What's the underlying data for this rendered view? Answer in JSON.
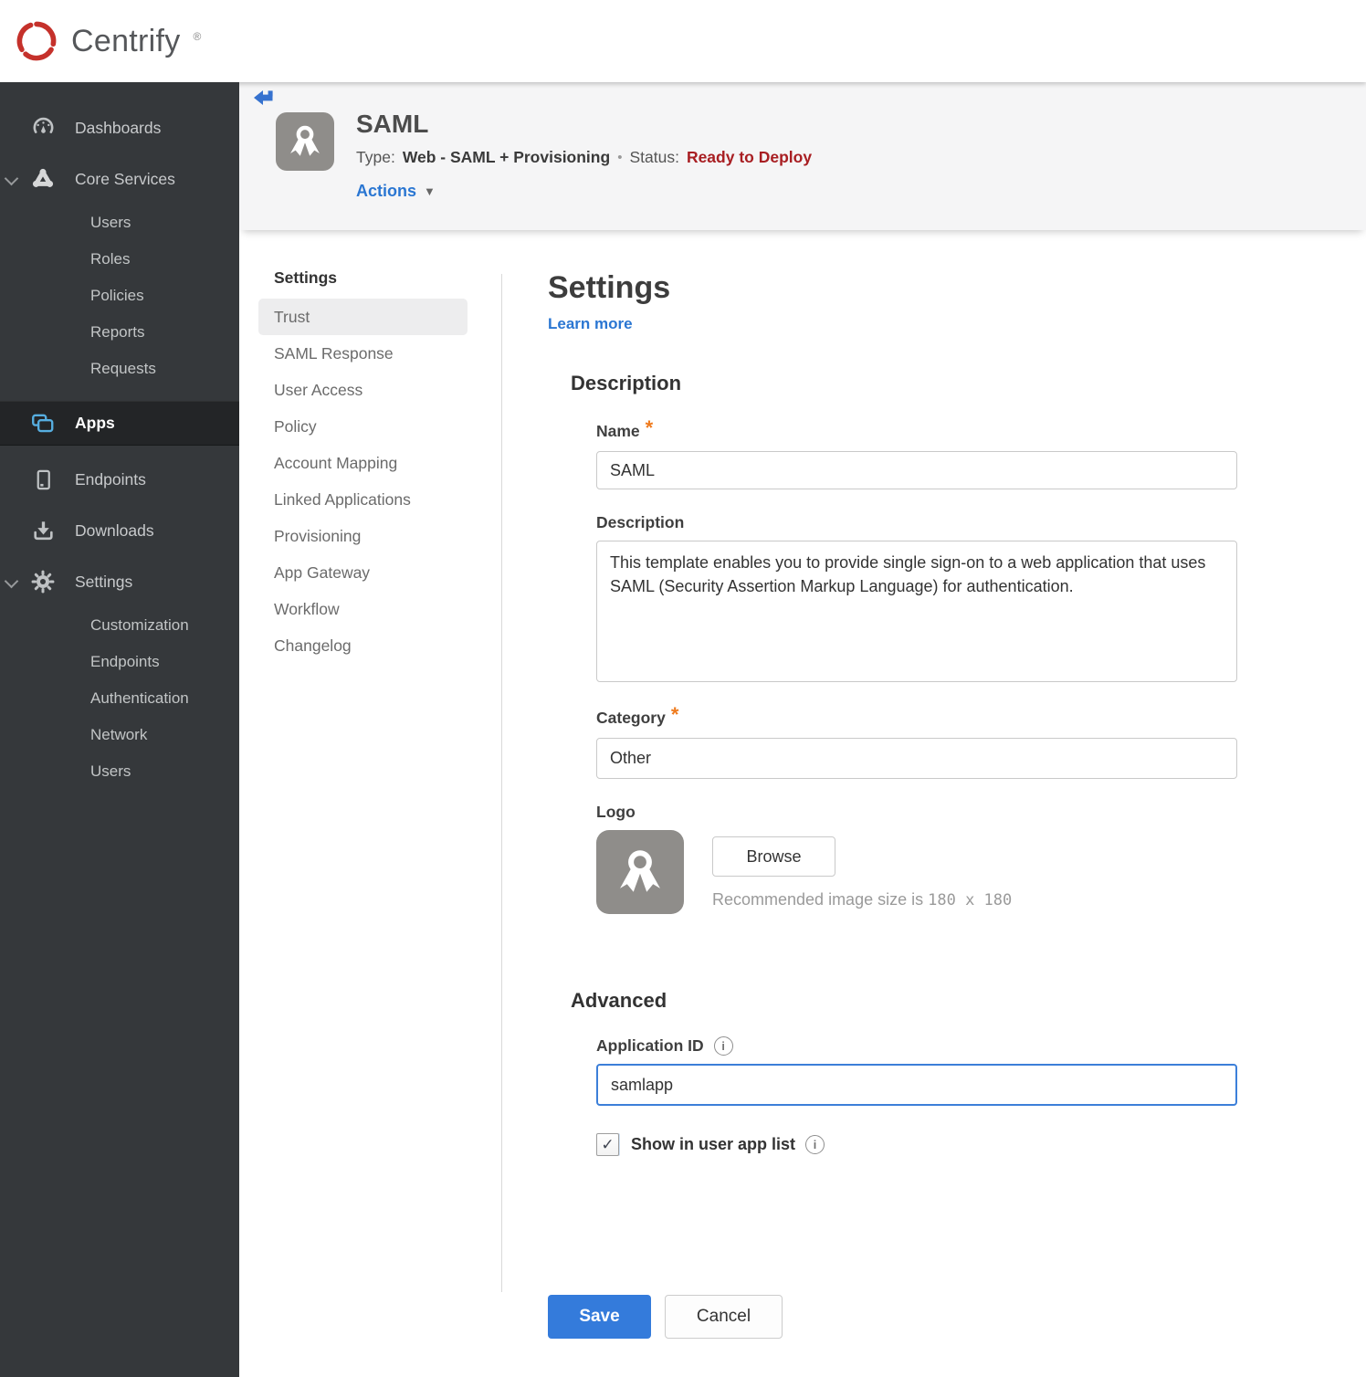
{
  "brand": {
    "name": "Centrify",
    "reg_mark": "®",
    "logo_color": "#c5312b"
  },
  "icons": {
    "checkmark": "✓",
    "dropdown_caret": "▼",
    "separator_dot": "•",
    "info": "i",
    "asterisk": "*"
  },
  "sidebar": {
    "dashboards": "Dashboards",
    "core_services": {
      "label": "Core Services",
      "expanded": true,
      "children": [
        "Users",
        "Roles",
        "Policies",
        "Reports",
        "Requests"
      ]
    },
    "apps": "Apps",
    "apps_selected": true,
    "apps_icon_color": "#56aee0",
    "endpoints": "Endpoints",
    "downloads": "Downloads",
    "settings": {
      "label": "Settings",
      "expanded": true,
      "children": [
        "Customization",
        "Endpoints",
        "Authentication",
        "Network",
        "Users"
      ]
    }
  },
  "app_header": {
    "title": "SAML",
    "type_label": "Type:",
    "type_value": "Web - SAML + Provisioning",
    "status_label": "Status:",
    "status_value": "Ready to Deploy",
    "status_color": "#a81e22",
    "actions_label": "Actions"
  },
  "subnav": {
    "header": "Settings",
    "selected": "Trust",
    "items": [
      "Trust",
      "SAML Response",
      "User Access",
      "Policy",
      "Account Mapping",
      "Linked Applications",
      "Provisioning",
      "App Gateway",
      "Workflow",
      "Changelog"
    ]
  },
  "main": {
    "title": "Settings",
    "learn_more": "Learn more",
    "description_section": {
      "heading": "Description",
      "name_label": "Name",
      "name_required": true,
      "name_value": "SAML",
      "description_label": "Description",
      "description_value": "This template enables you to provide single sign-on to a web application that uses SAML (Security Assertion Markup Language) for authentication.",
      "category_label": "Category",
      "category_required": true,
      "category_value": "Other",
      "logo_label": "Logo",
      "browse_button": "Browse",
      "recommended_prefix": "Recommended image size is",
      "recommended_size": "180 x 180"
    },
    "advanced_section": {
      "heading": "Advanced",
      "application_id_label": "Application ID",
      "application_id_value": "samlapp",
      "application_id_focused": true,
      "show_in_user_app_list_label": "Show in user app list",
      "checkbox_checked": true
    },
    "footer": {
      "save": "Save",
      "cancel": "Cancel"
    }
  },
  "colors": {
    "accent_blue": "#2a76d2",
    "save_blue": "#347bdb",
    "status_red": "#a81e22",
    "required_orange": "#ef7b1e",
    "sidebar_bg": "#35383b",
    "sidebar_selected_bg": "#232527",
    "header_band_bg": "#f5f5f6"
  }
}
